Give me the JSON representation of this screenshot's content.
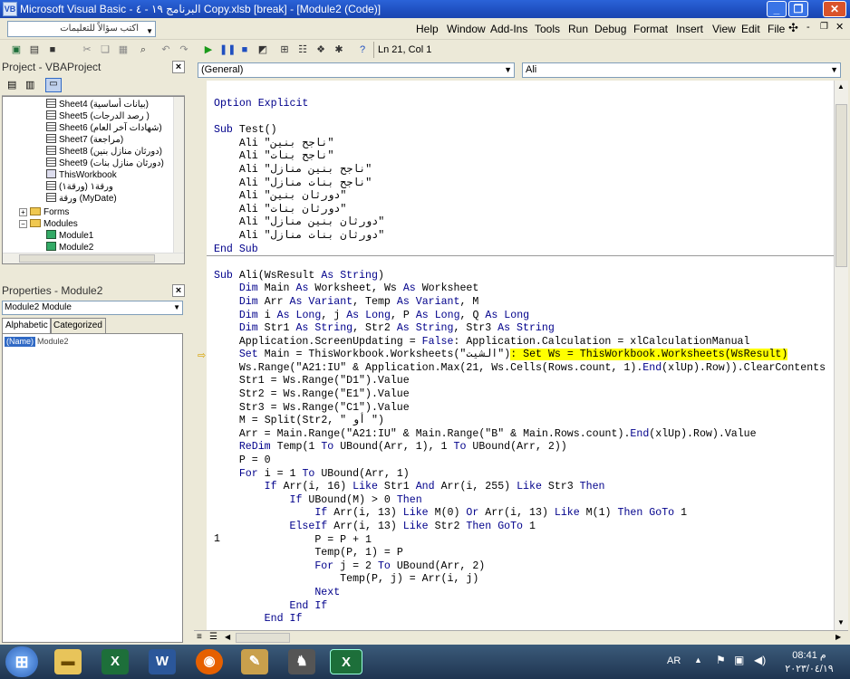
{
  "window": {
    "title": "Microsoft Visual Basic - البرنامج ١٩ - ٤ Copy.xlsb [break] - [Module2 (Code)]",
    "icon": "vba-app-icon"
  },
  "controls": {
    "minimize": "_",
    "restore": "❐",
    "close": "✕"
  },
  "ask": {
    "text": "اكتب سؤالاً للتعليمات"
  },
  "menus": [
    "Help",
    "Window",
    "Add-Ins",
    "Tools",
    "Run",
    "Debug",
    "Format",
    "Insert",
    "View",
    "Edit",
    "File"
  ],
  "toolbar": {
    "position": "Ln 21, Col 1"
  },
  "project": {
    "title": "Project - VBAProject",
    "items": [
      {
        "label": "Sheet4 (بيانات أساسية)",
        "type": "sheet"
      },
      {
        "label": "Sheet5 (رصد الدرجات )",
        "type": "sheet"
      },
      {
        "label": "Sheet6 (شهادات آخر العام)",
        "type": "sheet"
      },
      {
        "label": "Sheet7 (مراجعة)",
        "type": "sheet"
      },
      {
        "label": "Sheet8 (دورثان منازل بنين)",
        "type": "sheet"
      },
      {
        "label": "Sheet9 (دورثان منازل بنات)",
        "type": "sheet"
      },
      {
        "label": "ThisWorkbook",
        "type": "workbook"
      },
      {
        "label": "ورقة١ (ورقة١)",
        "type": "sheet"
      },
      {
        "label": "ورقة (MyDate)",
        "type": "sheet"
      },
      {
        "label": "Forms",
        "type": "folder"
      },
      {
        "label": "Modules",
        "type": "folder"
      },
      {
        "label": "Module1",
        "type": "module"
      },
      {
        "label": "Module2",
        "type": "module"
      }
    ]
  },
  "properties": {
    "title": "Properties - Module2",
    "object": "Module2 Module",
    "tabs": [
      "Alphabetic",
      "Categorized"
    ],
    "name_key": "(Name)",
    "name_value": "Module2"
  },
  "code": {
    "object_combo": "(General)",
    "proc_combo": "Ali",
    "break_line": "1",
    "lines": [
      "Option Explicit",
      "",
      "Sub Test()",
      "    Ali \"ناجح بنين\"",
      "    Ali \"ناجح بنات\"",
      "    Ali \"ناجح بنين منازل\"",
      "    Ali \"ناجح بنات منازل\"",
      "    Ali \"دورثان بنين\"",
      "    Ali \"دورثان بنات\"",
      "    Ali \"دورثان بنين منازل\"",
      "    Ali \"دورثان بنات منازل\"",
      "End Sub",
      "",
      "Sub Ali(WsResult As String)",
      "    Dim Main As Worksheet, Ws As Worksheet",
      "    Dim Arr As Variant, Temp As Variant, M",
      "    Dim i As Long, j As Long, P As Long, Q As Long",
      "    Dim Str1 As String, Str2 As String, Str3 As String",
      "    Application.ScreenUpdating = False: Application.Calculation = xlCalculationManual",
      "    Set Main = ThisWorkbook.Worksheets(\"الشيت\")",
      "    Ws.Range(\"A21:IU\" & Application.Max(21, Ws.Cells(Rows.count, 1).End(xlUp).Row)).ClearContents",
      "    Str1 = Ws.Range(\"D1\").Value",
      "    Str2 = Ws.Range(\"E1\").Value",
      "    Str3 = Ws.Range(\"C1\").Value",
      "    M = Split(Str2, \" أو \")",
      "    Arr = Main.Range(\"A21:IU\" & Main.Range(\"B\" & Main.Rows.count).End(xlUp).Row).Value",
      "    ReDim Temp(1 To UBound(Arr, 1), 1 To UBound(Arr, 2))",
      "    P = 0",
      "    For i = 1 To UBound(Arr, 1)",
      "        If Arr(i, 16) Like Str1 And Arr(i, 255) Like Str3 Then",
      "            If UBound(M) > 0 Then",
      "                If Arr(i, 13) Like M(0) Or Arr(i, 13) Like M(1) Then GoTo 1",
      "            ElseIf Arr(i, 13) Like Str2 Then GoTo 1",
      "                P = P + 1",
      "                Temp(P, 1) = P",
      "                For j = 2 To UBound(Arr, 2)",
      "                    Temp(P, j) = Arr(i, j)",
      "                Next",
      "            End If",
      "        End If"
    ],
    "highlight": ": Set Ws = ThisWorkbook.Worksheets(WsResult)"
  },
  "taskbar": {
    "lang": "AR",
    "time": "08:41 م",
    "date": "٢٠٢٣/٠٤/١٩"
  }
}
